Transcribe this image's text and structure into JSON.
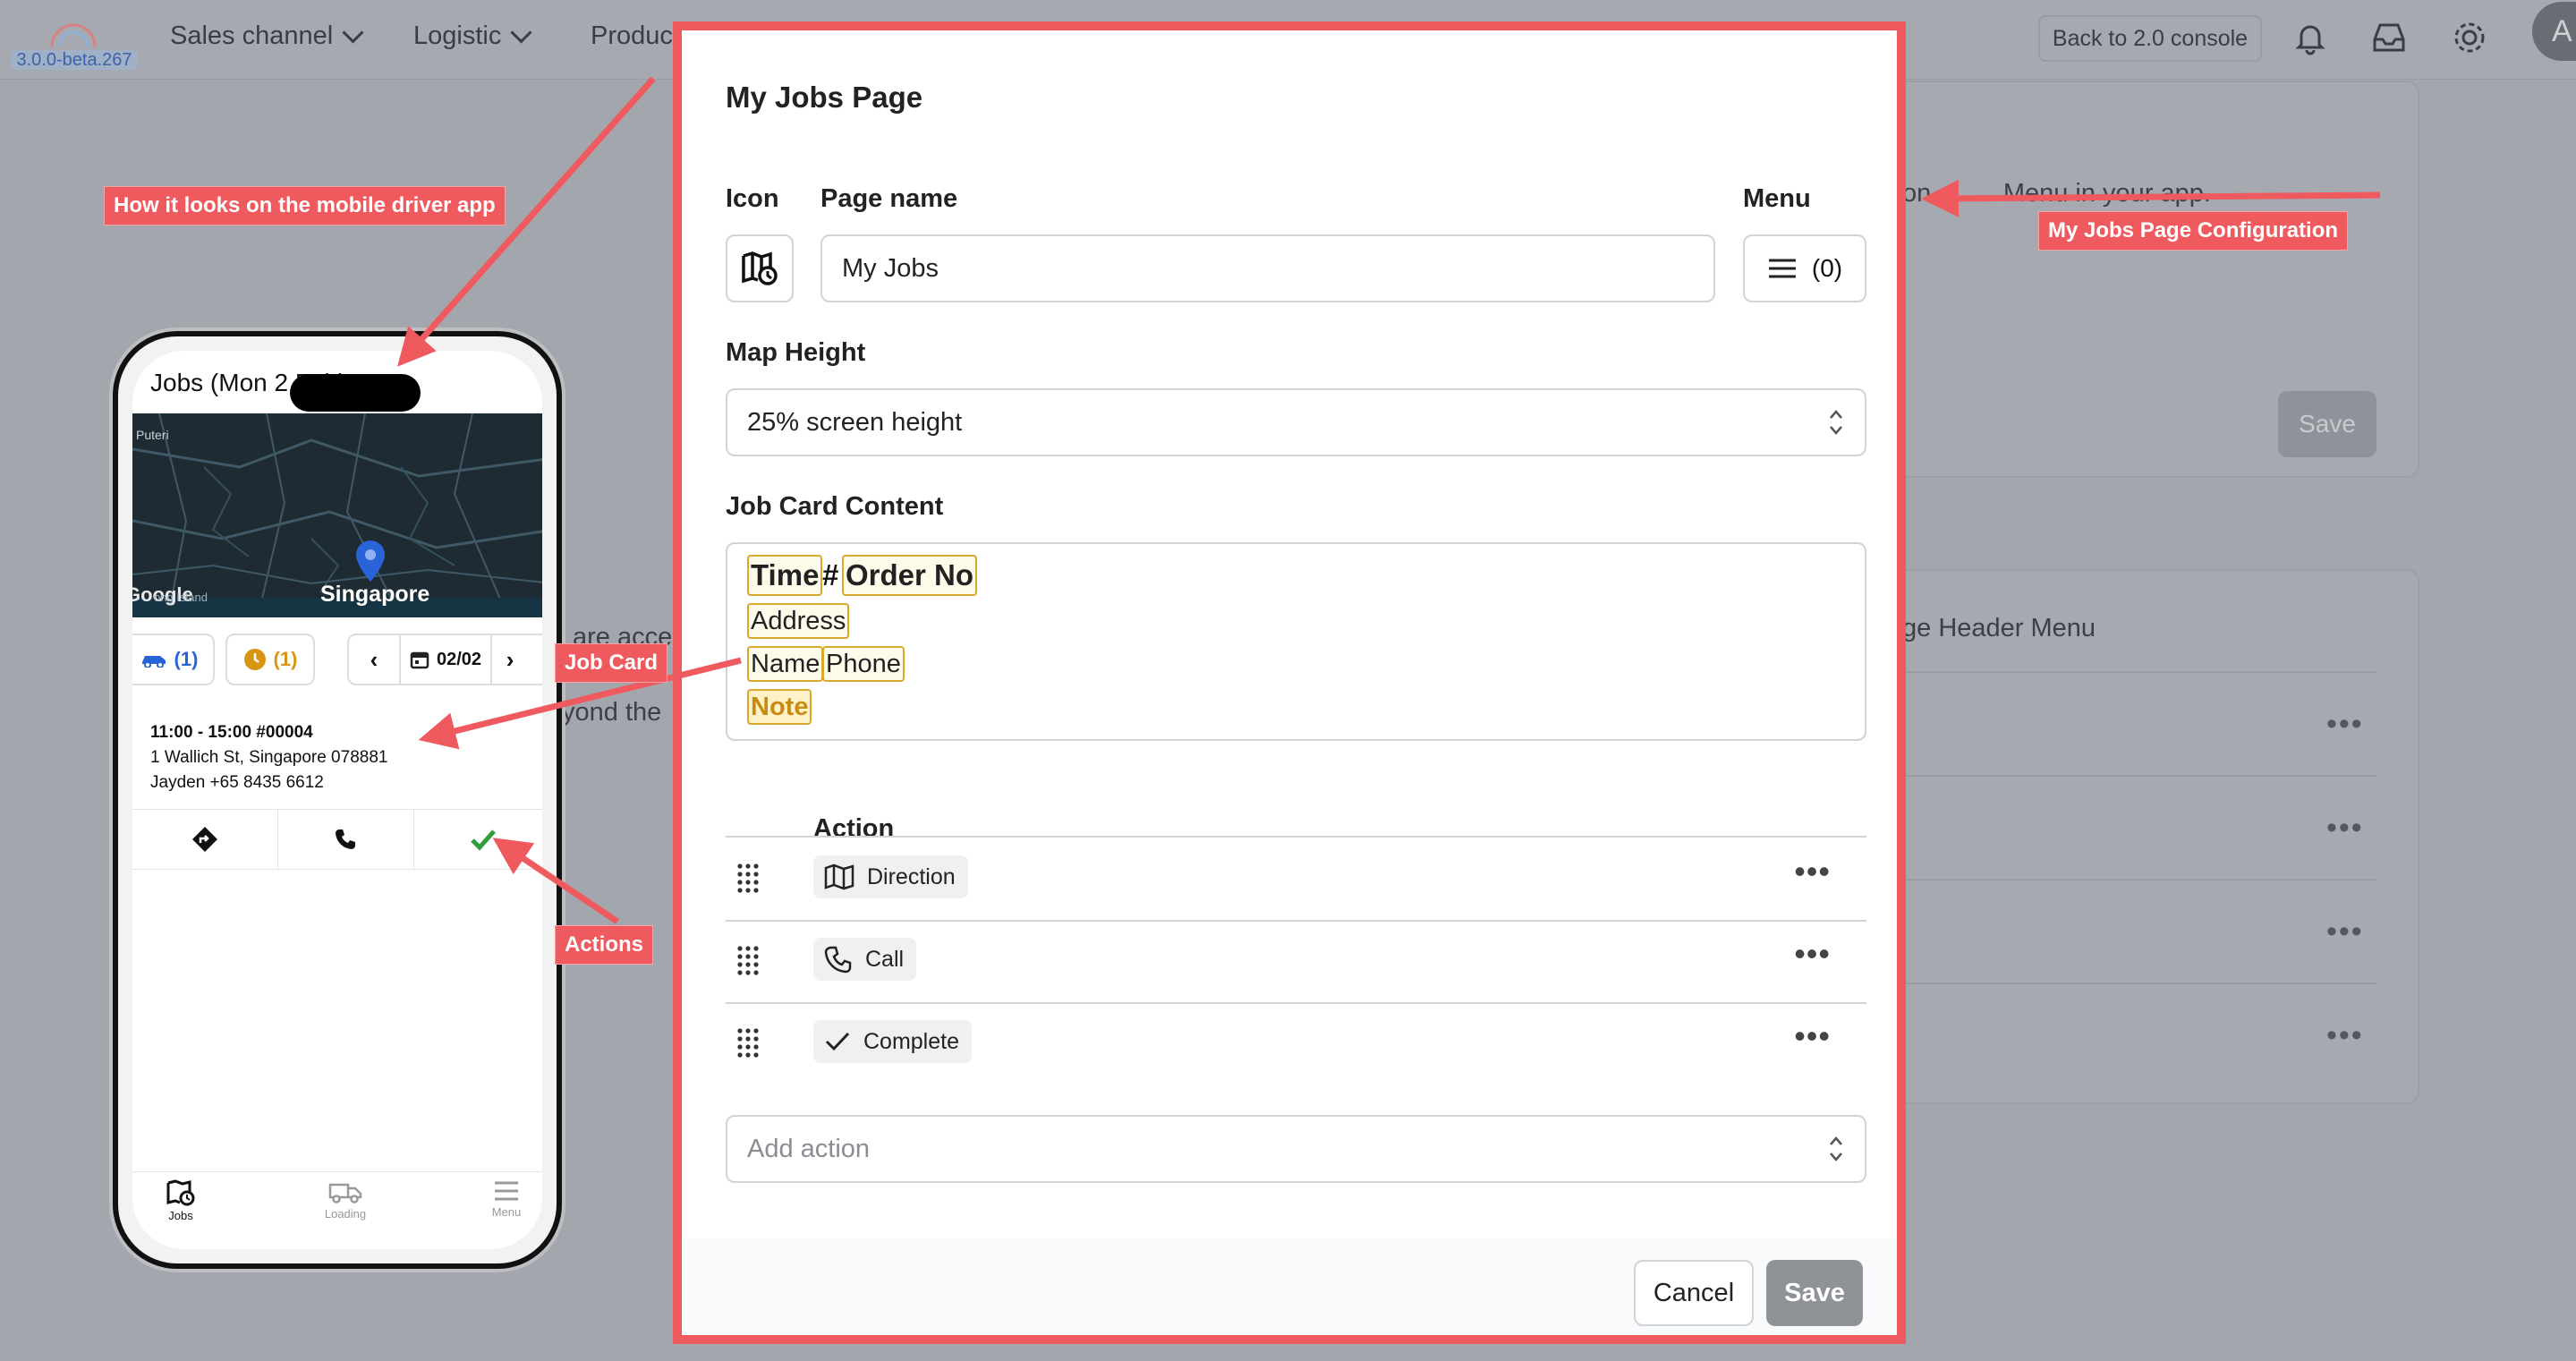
{
  "topnav": {
    "version": "3.0.0-beta.267",
    "items": [
      "Sales channel",
      "Logistic",
      "Produc"
    ],
    "back_button": "Back to 2.0 console",
    "avatar_initial": "A"
  },
  "background": {
    "fragment_menu_text": "on          Menu in your app.",
    "save_label": "Save",
    "page_header_menu_label": "ge Header Menu",
    "fragment_acce": "are acce",
    "fragment_yond": "yond the",
    "row_dots": "•••"
  },
  "annotations": {
    "mobile_label": "How it looks on the mobile driver app",
    "config_label": "My Jobs Page Configuration",
    "job_card_label": "Job Card",
    "actions_label": "Actions"
  },
  "phone": {
    "title": "Jobs (Mon 2 Feb)",
    "map_city": "Singapore",
    "map_corner": "Puteri",
    "map_watermark": "Google",
    "map_place": "ong Island",
    "chip_vehicle_count": "(1)",
    "chip_pending_count": "(1)",
    "date": "02/02",
    "job": {
      "line1": "11:00 - 15:00 #00004",
      "line2": "1 Wallich St, Singapore 078881",
      "line3": "Jayden +65 8435 6612"
    },
    "tabs": [
      "Jobs",
      "Loading",
      "Menu"
    ]
  },
  "modal": {
    "title": "My Jobs Page",
    "icon_label": "Icon",
    "page_name_label": "Page name",
    "page_name_value": "My Jobs",
    "menu_label": "Menu",
    "menu_count": "(0)",
    "map_height_label": "Map Height",
    "map_height_value": "25% screen height",
    "job_card_label": "Job Card Content",
    "tokens": {
      "time": "Time",
      "hash": "#",
      "order_no": "Order No",
      "address": "Address",
      "name": "Name",
      "phone": "Phone",
      "note": "Note"
    },
    "action_header": "Action",
    "actions": [
      {
        "label": "Direction",
        "icon": "map-icon"
      },
      {
        "label": "Call",
        "icon": "phone-icon"
      },
      {
        "label": "Complete",
        "icon": "check-icon"
      }
    ],
    "row_menu": "•••",
    "add_action_placeholder": "Add action",
    "cancel_label": "Cancel",
    "save_label": "Save"
  },
  "colors": {
    "annotation_red": "#ef5a5f",
    "token_border": "#d9a92f",
    "save_disabled": "#8f9297",
    "phone_accent_blue": "#2a62d8",
    "phone_accent_orange": "#d79511",
    "complete_green": "#2e9d3a"
  }
}
